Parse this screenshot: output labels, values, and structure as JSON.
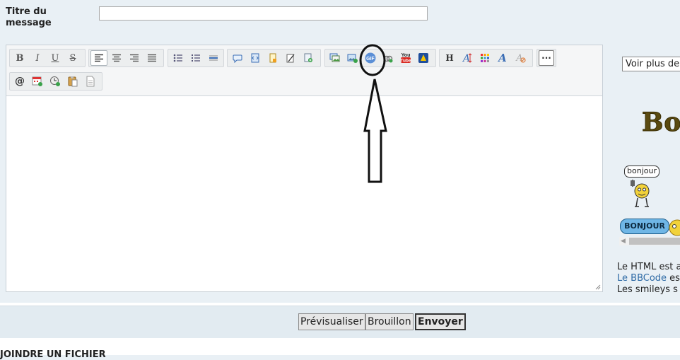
{
  "form": {
    "title_label": "Titre du message",
    "title_value": ""
  },
  "toolbar": {
    "bold_label": "B",
    "italic_label": "I",
    "underline_label": "U",
    "strike_label": "S",
    "heading_label": "H",
    "more_label": "···"
  },
  "sidebar": {
    "select_value": "Voir plus de",
    "smiley_bon_text": "Bon",
    "bubble_bonjour": "bonjour",
    "bubble_blue": "BONJOUR",
    "info_html": "Le HTML est a",
    "info_bbcode_link": "Le BBCode",
    "info_bbcode_rest": " es",
    "info_smileys": "Les smileys s"
  },
  "actions": {
    "preview_label": "Prévisualiser",
    "draft_label": "Brouillon",
    "send_label": "Envoyer"
  },
  "footer": {
    "joindre_label": "JOINDRE UN FICHIER"
  },
  "colors": {
    "background": "#e9f0f5",
    "action_bar": "#e2ebf1",
    "link": "#2e6aa5",
    "annotation": "#111111"
  }
}
